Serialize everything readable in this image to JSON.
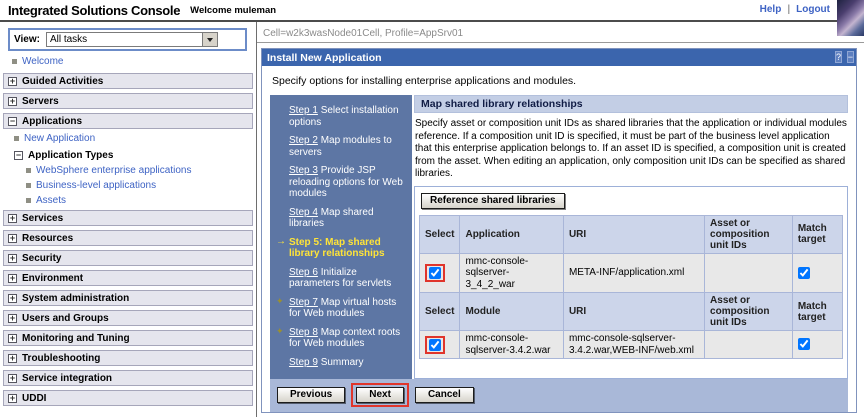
{
  "banner": {
    "title": "Integrated Solutions Console",
    "welcome": "Welcome muleman",
    "help": "Help",
    "logout": "Logout"
  },
  "sidebar": {
    "view_label": "View:",
    "view_value": "All tasks",
    "welcome_label": "Welcome",
    "sections": [
      {
        "label": "Guided Activities"
      },
      {
        "label": "Servers"
      },
      {
        "label": "Applications"
      },
      {
        "label": "Services"
      },
      {
        "label": "Resources"
      },
      {
        "label": "Security"
      },
      {
        "label": "Environment"
      },
      {
        "label": "System administration"
      },
      {
        "label": "Users and Groups"
      },
      {
        "label": "Monitoring and Tuning"
      },
      {
        "label": "Troubleshooting"
      },
      {
        "label": "Service integration"
      },
      {
        "label": "UDDI"
      }
    ],
    "applications_children": {
      "new_application": "New Application",
      "application_types": "Application Types",
      "types": [
        "WebSphere enterprise applications",
        "Business-level applications",
        "Assets"
      ]
    }
  },
  "main": {
    "breadcrumb": "Cell=w2k3wasNode01Cell, Profile=AppSrv01",
    "panel_title": "Install New Application",
    "instruction": "Specify options for installing enterprise applications and modules.",
    "steps": [
      {
        "num": "Step 1",
        "text": "Select installation options"
      },
      {
        "num": "Step 2",
        "text": "Map modules to servers"
      },
      {
        "num": "Step 3",
        "text": "Provide JSP reloading options for Web modules"
      },
      {
        "num": "Step 4",
        "text": "Map shared libraries"
      },
      {
        "num": "Step 5:",
        "text": "Map shared library relationships"
      },
      {
        "num": "Step 6",
        "text": "Initialize parameters for servlets"
      },
      {
        "num": "Step 7",
        "text": "Map virtual hosts for Web modules"
      },
      {
        "num": "Step 8",
        "text": "Map context roots for Web modules"
      },
      {
        "num": "Step 9",
        "text": "Summary"
      }
    ],
    "section": {
      "title": "Map shared library relationships",
      "description": "Specify asset or composition unit IDs as shared libraries that the application or individual modules reference. If a composition unit ID is specified, it must be part of the business level application that this enterprise application belongs to. If an asset ID is specified, a composition unit is created from the asset. When editing an application, only composition unit IDs can be specified as shared libraries.",
      "reference_button": "Reference shared libraries",
      "table": {
        "app_header": [
          "Select",
          "Application",
          "URI",
          "Asset or composition unit IDs",
          "Match target"
        ],
        "module_header": [
          "Select",
          "Module",
          "URI",
          "Asset or composition unit IDs",
          "Match target"
        ],
        "app_row": {
          "name": "mmc-console-sqlserver-3_4_2_war",
          "uri": "META-INF/application.xml",
          "asset_ids": "",
          "selected": true,
          "match_target": true
        },
        "module_row": {
          "name": "mmc-console-sqlserver-3.4.2.war",
          "uri": "mmc-console-sqlserver-3.4.2.war,WEB-INF/web.xml",
          "asset_ids": "",
          "selected": true,
          "match_target": true
        }
      }
    },
    "buttons": {
      "previous": "Previous",
      "next": "Next",
      "cancel": "Cancel"
    }
  },
  "icons": {
    "expand": "+",
    "collapse": "−",
    "help": "?",
    "minimize": "−",
    "arrow": "→",
    "star": "✦"
  },
  "colors": {
    "titlebar_bg": "#3b65ad",
    "steps_bg": "#5d76a4",
    "current_step_yellow": "#ffe438",
    "section_header_bg": "#c3cee5",
    "table_header_bg": "#ccd5ea",
    "table_cell_bg": "#e8e8e8",
    "footer_bg": "#a9b8d8",
    "annotation_red": "#e0352b",
    "link_blue": "#3e63c4"
  }
}
